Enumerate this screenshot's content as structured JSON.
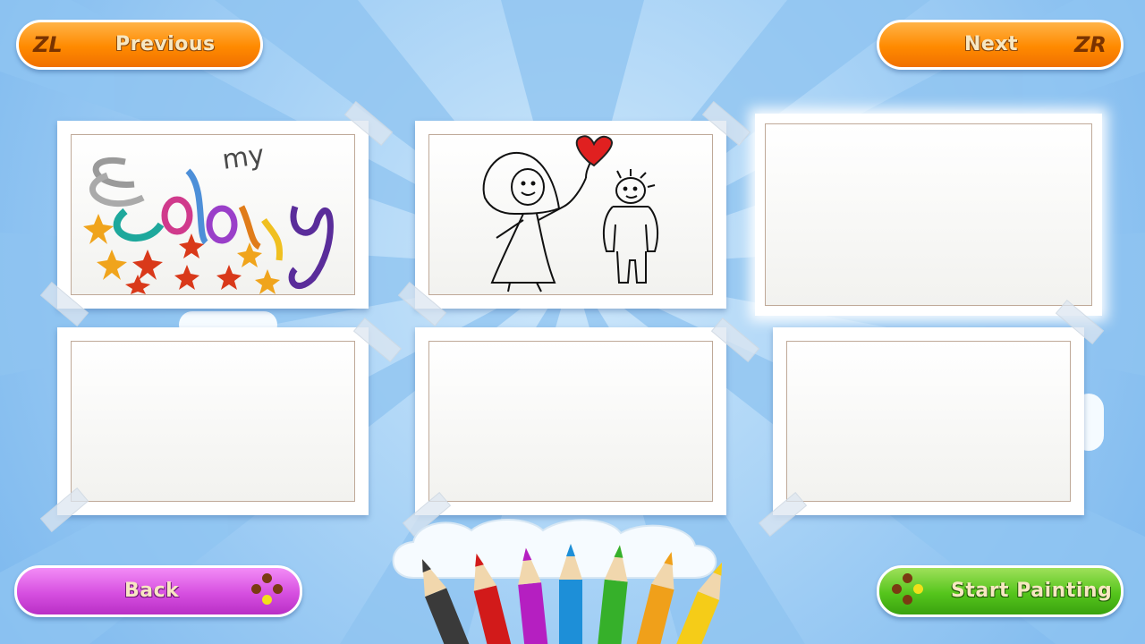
{
  "nav": {
    "previous": {
      "key": "ZL",
      "label": "Previous"
    },
    "next": {
      "label": "Next",
      "key": "ZR"
    }
  },
  "gallery": {
    "slots": [
      {
        "content": "my-coloring-drawing",
        "selected": false
      },
      {
        "content": "stick-figures-with-balloon-drawing",
        "selected": false
      },
      {
        "content": "empty",
        "selected": true
      },
      {
        "content": "empty",
        "selected": false
      },
      {
        "content": "empty",
        "selected": false
      },
      {
        "content": "empty",
        "selected": false
      }
    ]
  },
  "footer": {
    "back_label": "Back",
    "start_label": "Start Painting"
  },
  "colors": {
    "orange_button": "#ff8a00",
    "purple_button": "#d64fe0",
    "green_button": "#55c51c",
    "background": "#7cb8ee"
  },
  "pencil_colors": [
    "#3a3a3a",
    "#d21a1a",
    "#b51fc1",
    "#1d8fd8",
    "#36b02a",
    "#f0a01a",
    "#f5cc18"
  ]
}
